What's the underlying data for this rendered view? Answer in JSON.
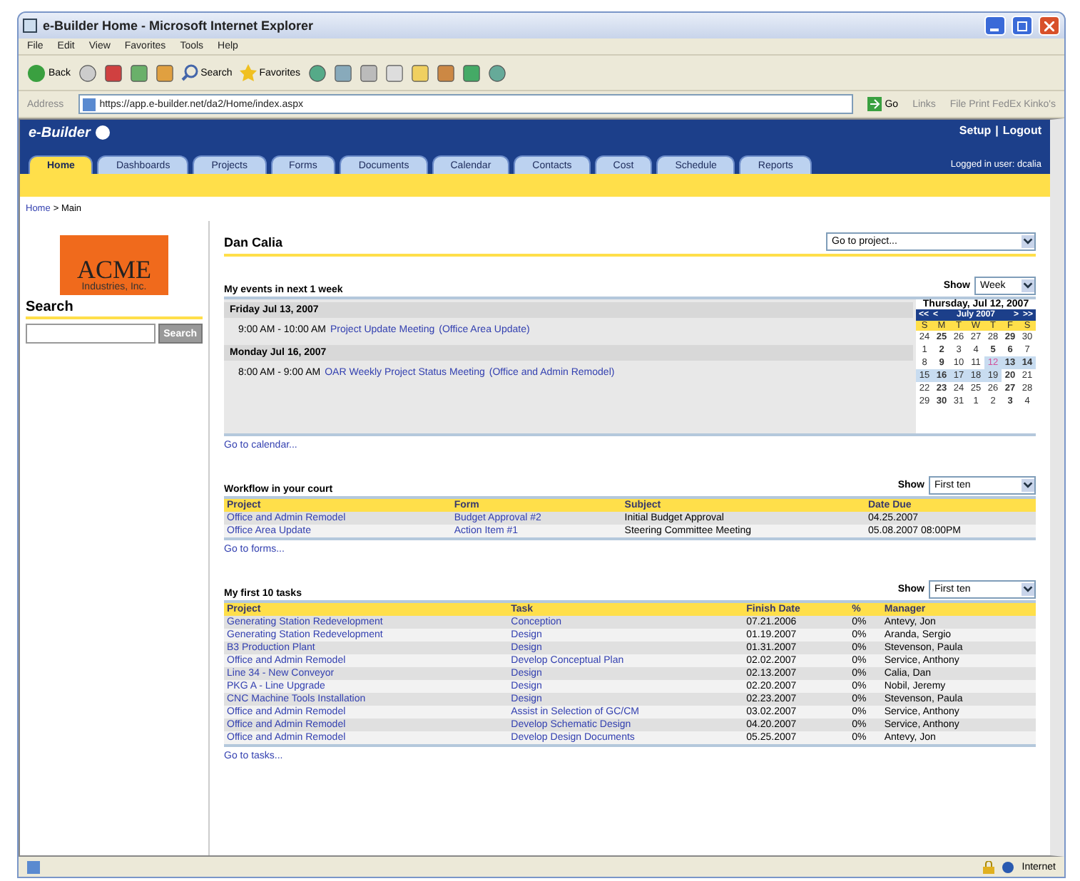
{
  "window": {
    "title": "e-Builder Home - Microsoft Internet Explorer"
  },
  "menu": [
    "File",
    "Edit",
    "View",
    "Favorites",
    "Tools",
    "Help"
  ],
  "toolbar": {
    "back": "Back",
    "search": "Search",
    "favorites": "Favorites"
  },
  "address": {
    "label": "Address",
    "url": "https://app.e-builder.net/da2/Home/index.aspx",
    "go": "Go",
    "links": "Links",
    "link_item": "File Print FedEx Kinko's"
  },
  "header": {
    "logo": "e-Builder",
    "setup": "Setup",
    "separator": "|",
    "logout": "Logout",
    "logged_in": "Logged in user: dcalia"
  },
  "tabs": [
    {
      "label": "Home",
      "selected": true
    },
    {
      "label": "Dashboards",
      "selected": false
    },
    {
      "label": "Projects",
      "selected": false
    },
    {
      "label": "Forms",
      "selected": false
    },
    {
      "label": "Documents",
      "selected": false
    },
    {
      "label": "Calendar",
      "selected": false
    },
    {
      "label": "Contacts",
      "selected": false
    },
    {
      "label": "Cost",
      "selected": false
    },
    {
      "label": "Schedule",
      "selected": false
    },
    {
      "label": "Reports",
      "selected": false
    }
  ],
  "breadcrumb": {
    "link": "Home",
    "rest": "> Main"
  },
  "company_logo": {
    "name": "ACME",
    "subtitle": "Industries, Inc."
  },
  "search": {
    "title": "Search",
    "button": "Search"
  },
  "user": {
    "name": "Dan Calia",
    "project_select": "Go to project..."
  },
  "events": {
    "title": "My events in next 1 week",
    "show_label": "Show",
    "show_value": "Week",
    "go_link": "Go to calendar...",
    "days": [
      {
        "date": "Friday Jul 13, 2007",
        "items": [
          {
            "time": "9:00 AM - 10:00 AM",
            "title": "Project Update Meeting",
            "project": "(Office Area Update)"
          }
        ]
      },
      {
        "date": "Monday Jul 16, 2007",
        "items": [
          {
            "time": "8:00 AM - 9:00 AM",
            "title": "OAR Weekly Project Status Meeting",
            "project": "(Office and Admin Remodel)"
          }
        ]
      }
    ]
  },
  "calendar": {
    "heading": "Thursday, Jul 12, 2007",
    "prev_year": "<<",
    "prev": "<",
    "month": "July 2007",
    "next": ">",
    "next_year": ">>",
    "weekdays": [
      "S",
      "M",
      "T",
      "W",
      "T",
      "F",
      "S"
    ],
    "days": [
      {
        "day": "24",
        "bold": false,
        "in_week": false,
        "today": false
      },
      {
        "day": "25",
        "bold": true,
        "in_week": false,
        "today": false
      },
      {
        "day": "26",
        "bold": false,
        "in_week": false,
        "today": false
      },
      {
        "day": "27",
        "bold": false,
        "in_week": false,
        "today": false
      },
      {
        "day": "28",
        "bold": false,
        "in_week": false,
        "today": false
      },
      {
        "day": "29",
        "bold": true,
        "in_week": false,
        "today": false
      },
      {
        "day": "30",
        "bold": false,
        "in_week": false,
        "today": false
      },
      {
        "day": "1",
        "bold": false,
        "in_week": false,
        "today": false
      },
      {
        "day": "2",
        "bold": true,
        "in_week": false,
        "today": false
      },
      {
        "day": "3",
        "bold": false,
        "in_week": false,
        "today": false
      },
      {
        "day": "4",
        "bold": false,
        "in_week": false,
        "today": false
      },
      {
        "day": "5",
        "bold": true,
        "in_week": false,
        "today": false
      },
      {
        "day": "6",
        "bold": true,
        "in_week": false,
        "today": false
      },
      {
        "day": "7",
        "bold": false,
        "in_week": false,
        "today": false
      },
      {
        "day": "8",
        "bold": false,
        "in_week": false,
        "today": false
      },
      {
        "day": "9",
        "bold": true,
        "in_week": false,
        "today": false
      },
      {
        "day": "10",
        "bold": false,
        "in_week": false,
        "today": false
      },
      {
        "day": "11",
        "bold": false,
        "in_week": false,
        "today": false
      },
      {
        "day": "12",
        "bold": false,
        "in_week": true,
        "today": true
      },
      {
        "day": "13",
        "bold": true,
        "in_week": true,
        "today": false
      },
      {
        "day": "14",
        "bold": true,
        "in_week": true,
        "today": false
      },
      {
        "day": "15",
        "bold": false,
        "in_week": true,
        "today": false
      },
      {
        "day": "16",
        "bold": true,
        "in_week": true,
        "today": false
      },
      {
        "day": "17",
        "bold": false,
        "in_week": true,
        "today": false
      },
      {
        "day": "18",
        "bold": false,
        "in_week": true,
        "today": false
      },
      {
        "day": "19",
        "bold": false,
        "in_week": true,
        "today": false
      },
      {
        "day": "20",
        "bold": true,
        "in_week": false,
        "today": false
      },
      {
        "day": "21",
        "bold": false,
        "in_week": false,
        "today": false
      },
      {
        "day": "22",
        "bold": false,
        "in_week": false,
        "today": false
      },
      {
        "day": "23",
        "bold": true,
        "in_week": false,
        "today": false
      },
      {
        "day": "24",
        "bold": false,
        "in_week": false,
        "today": false
      },
      {
        "day": "25",
        "bold": false,
        "in_week": false,
        "today": false
      },
      {
        "day": "26",
        "bold": false,
        "in_week": false,
        "today": false
      },
      {
        "day": "27",
        "bold": true,
        "in_week": false,
        "today": false
      },
      {
        "day": "28",
        "bold": false,
        "in_week": false,
        "today": false
      },
      {
        "day": "29",
        "bold": false,
        "in_week": false,
        "today": false
      },
      {
        "day": "30",
        "bold": true,
        "in_week": false,
        "today": false
      },
      {
        "day": "31",
        "bold": false,
        "in_week": false,
        "today": false
      },
      {
        "day": "1",
        "bold": false,
        "in_week": false,
        "today": false
      },
      {
        "day": "2",
        "bold": false,
        "in_week": false,
        "today": false
      },
      {
        "day": "3",
        "bold": true,
        "in_week": false,
        "today": false
      },
      {
        "day": "4",
        "bold": false,
        "in_week": false,
        "today": false
      }
    ]
  },
  "workflow": {
    "title": "Workflow in your court",
    "show_label": "Show",
    "show_value": "First ten",
    "go_link": "Go to forms...",
    "columns": [
      "Project",
      "Form",
      "Subject",
      "Date Due"
    ],
    "rows": [
      [
        "Office and Admin Remodel",
        "Budget Approval #2",
        "Initial Budget Approval",
        "04.25.2007"
      ],
      [
        "Office Area Update",
        "Action Item #1",
        "Steering Committee Meeting",
        "05.08.2007 08:00PM"
      ]
    ]
  },
  "tasks": {
    "title": "My first 10 tasks",
    "show_label": "Show",
    "show_value": "First ten",
    "go_link": "Go to tasks...",
    "columns": [
      "Project",
      "Task",
      "Finish Date",
      "%",
      "Manager"
    ],
    "rows": [
      [
        "Generating Station Redevelopment",
        "Conception",
        "07.21.2006",
        "0%",
        "Antevy, Jon"
      ],
      [
        "Generating Station Redevelopment",
        "Design",
        "01.19.2007",
        "0%",
        "Aranda, Sergio"
      ],
      [
        "B3 Production Plant",
        "Design",
        "01.31.2007",
        "0%",
        "Stevenson, Paula"
      ],
      [
        "Office and Admin Remodel",
        "Develop Conceptual Plan",
        "02.02.2007",
        "0%",
        "Service, Anthony"
      ],
      [
        "Line 34 - New Conveyor",
        "Design",
        "02.13.2007",
        "0%",
        "Calia, Dan"
      ],
      [
        "PKG A - Line Upgrade",
        "Design",
        "02.20.2007",
        "0%",
        "Nobil, Jeremy"
      ],
      [
        "CNC Machine Tools Installation",
        "Design",
        "02.23.2007",
        "0%",
        "Stevenson, Paula"
      ],
      [
        "Office and Admin Remodel",
        "Assist in Selection of GC/CM",
        "03.02.2007",
        "0%",
        "Service, Anthony"
      ],
      [
        "Office and Admin Remodel",
        "Develop Schematic Design",
        "04.20.2007",
        "0%",
        "Service, Anthony"
      ],
      [
        "Office and Admin Remodel",
        "Develop Design Documents",
        "05.25.2007",
        "0%",
        "Antevy, Jon"
      ]
    ]
  },
  "status_bar": {
    "zone": "Internet"
  }
}
